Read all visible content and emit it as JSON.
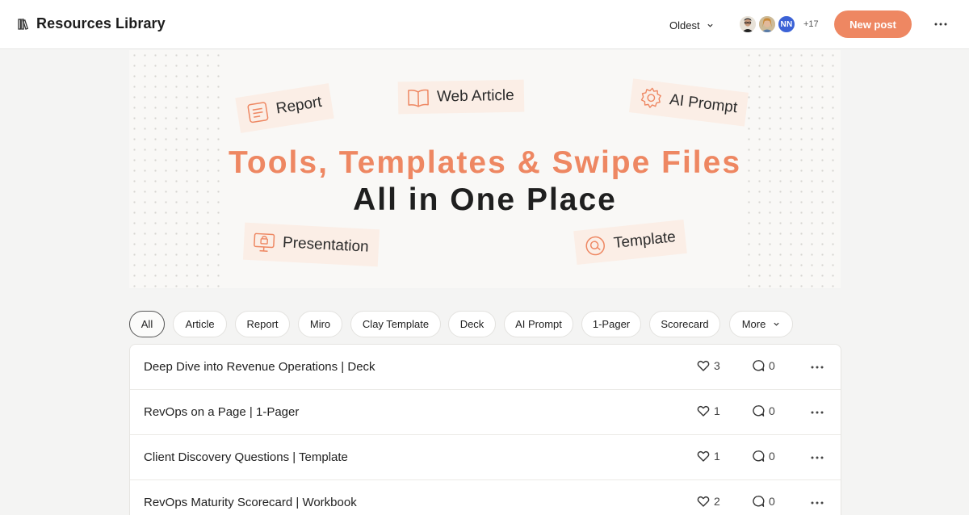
{
  "header": {
    "title": "Resources Library",
    "sort_label": "Oldest",
    "avatar_initials": "NN",
    "avatar_more": "+17",
    "new_post_label": "New post"
  },
  "hero": {
    "line1": "Tools, Templates & Swipe Files",
    "line2": "All in One Place",
    "tags": {
      "report": "Report",
      "web_article": "Web Article",
      "ai_prompt": "AI Prompt",
      "presentation": "Presentation",
      "template": "Template"
    }
  },
  "filters": [
    "All",
    "Article",
    "Report",
    "Miro",
    "Clay Template",
    "Deck",
    "AI Prompt",
    "1-Pager",
    "Scorecard",
    "More"
  ],
  "posts": [
    {
      "title": "Deep Dive into Revenue Operations | Deck",
      "likes": "3",
      "comments": "0"
    },
    {
      "title": "RevOps on a Page | 1-Pager",
      "likes": "1",
      "comments": "0"
    },
    {
      "title": "Client Discovery Questions | Template",
      "likes": "1",
      "comments": "0"
    },
    {
      "title": "RevOps Maturity Scorecard | Workbook",
      "likes": "2",
      "comments": "0"
    }
  ],
  "colors": {
    "accent": "#ee8762",
    "tag_background": "#fbeee6",
    "avatar_blue": "#3b62d6"
  },
  "icons": {
    "library": "library-icon",
    "sort": "chevron-down-icon",
    "more": "more-horizontal-icon",
    "like": "heart-icon",
    "comment": "comment-icon",
    "report": "document-icon",
    "web_article": "open-book-icon",
    "ai_prompt": "gear-icon",
    "presentation": "presentation-board-icon",
    "template": "search-icon"
  }
}
